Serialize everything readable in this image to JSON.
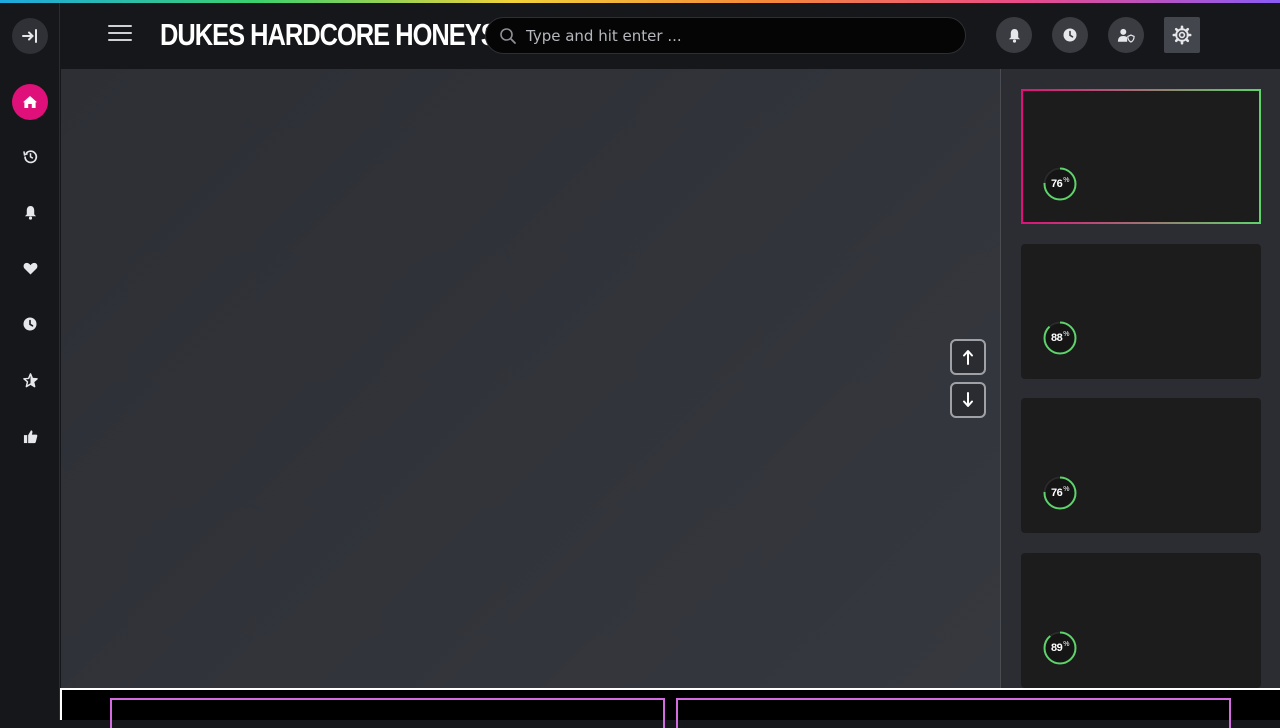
{
  "header": {
    "brand": "DUKES HARDCORE HONEYS",
    "search_placeholder": "Type and hit enter ..."
  },
  "icons": {
    "leftbar": [
      "sign-in-icon",
      "home-icon",
      "history-icon",
      "bell-icon",
      "heart-icon",
      "clock-icon",
      "star-icon",
      "thumbs-up-icon"
    ],
    "topbar": [
      "bell-icon",
      "clock-icon",
      "user-shield-icon",
      "gear-icon"
    ],
    "scroll": [
      "arrow-up-icon",
      "arrow-down-icon"
    ]
  },
  "colors": {
    "accent": "#e0107a",
    "score_ring": "#5fd36b",
    "promo_border": "#d46be0"
  },
  "cards": [
    {
      "score": "76",
      "unit": "%",
      "active": true
    },
    {
      "score": "88",
      "unit": "%",
      "active": false
    },
    {
      "score": "76",
      "unit": "%",
      "active": false
    },
    {
      "score": "89",
      "unit": "%",
      "active": false
    }
  ]
}
